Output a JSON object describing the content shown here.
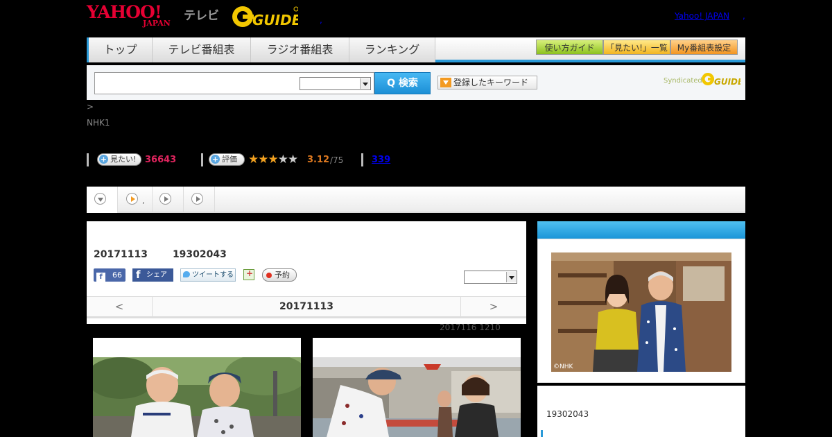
{
  "header": {
    "yahoo_logo": "YAHOO!",
    "japan_logo": "JAPAN",
    "tv_label": "テレビ",
    "gguide_logo": "G GUIDE",
    "yahoo_japan_link": "Yahoo! JAPAN",
    "sep": ",",
    "sep2": ","
  },
  "nav": {
    "tabs": [
      "トップ",
      "テレビ番組表",
      "ラジオ番組表",
      "ランキング"
    ],
    "utility": [
      "使い方ガイド",
      "「見たい!」一覧",
      "My番組表設定"
    ]
  },
  "search": {
    "button_label": "Q 検索",
    "keyword_button": "登録したキーワード",
    "syndicated": "Syndicated"
  },
  "breadcrumb": ">",
  "channel": "NHK1",
  "stats": {
    "want_label": "見たい!",
    "want_count": "36643",
    "rate_label": "評価",
    "stars": "★★★",
    "stars_off": "★★",
    "rating": "3.12",
    "rating_max": "/75",
    "comments": "339"
  },
  "tabs": {
    "dot": ","
  },
  "program": {
    "date_code": "20171113",
    "program_code": "19302043",
    "fb_like_count": "66",
    "fb_share": "シェア",
    "tweet": "ツイートする",
    "reserve": "予約",
    "prev": "<",
    "current_date": "20171113",
    "next": ">",
    "updated": "2017116  1210"
  },
  "right_panel": {
    "code": "19302043",
    "nhk_mark": "©NHK"
  }
}
